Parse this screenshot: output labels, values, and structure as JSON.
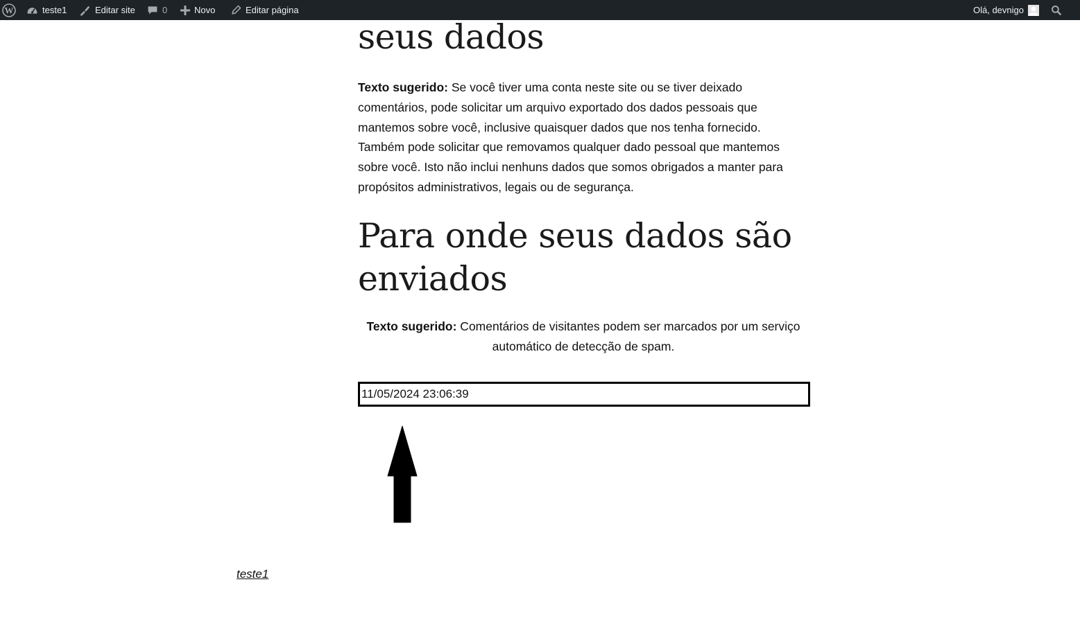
{
  "adminbar": {
    "site_name": "teste1",
    "edit_site": "Editar site",
    "comments_count": "0",
    "new_label": "Novo",
    "edit_page": "Editar página",
    "greeting": "Olá, devnigo",
    "icons": [
      "wordpress-logo-icon",
      "dashboard-icon",
      "brush-icon",
      "comment-icon",
      "plus-icon",
      "pencil-icon",
      "avatar",
      "search-icon"
    ]
  },
  "main": {
    "heading_top": "seus dados",
    "para1_label": "Texto sugerido:",
    "para1_text": " Se você tiver uma conta neste site ou se tiver deixado comentários, pode solicitar um arquivo exportado dos dados pessoais que mantemos sobre você, inclusive quaisquer dados que nos tenha fornecido. Também pode solicitar que removamos qualquer dado pessoal que mantemos sobre você. Isto não inclui nenhuns dados que somos obrigados a manter para propósitos administrativos, legais ou de segurança.",
    "heading_mid": "Para onde seus dados são enviados",
    "para2_label": "Texto sugerido:",
    "para2_text": " Comentários de visitantes podem ser marcados por um serviço automático de detecção de spam.",
    "timestamp": "11/05/2024 23:06:39"
  },
  "footer": {
    "site_link": "teste1"
  },
  "colors": {
    "adminbar_bg": "#1d2327",
    "adminbar_text": "#f0f0f1",
    "text": "#111111"
  }
}
